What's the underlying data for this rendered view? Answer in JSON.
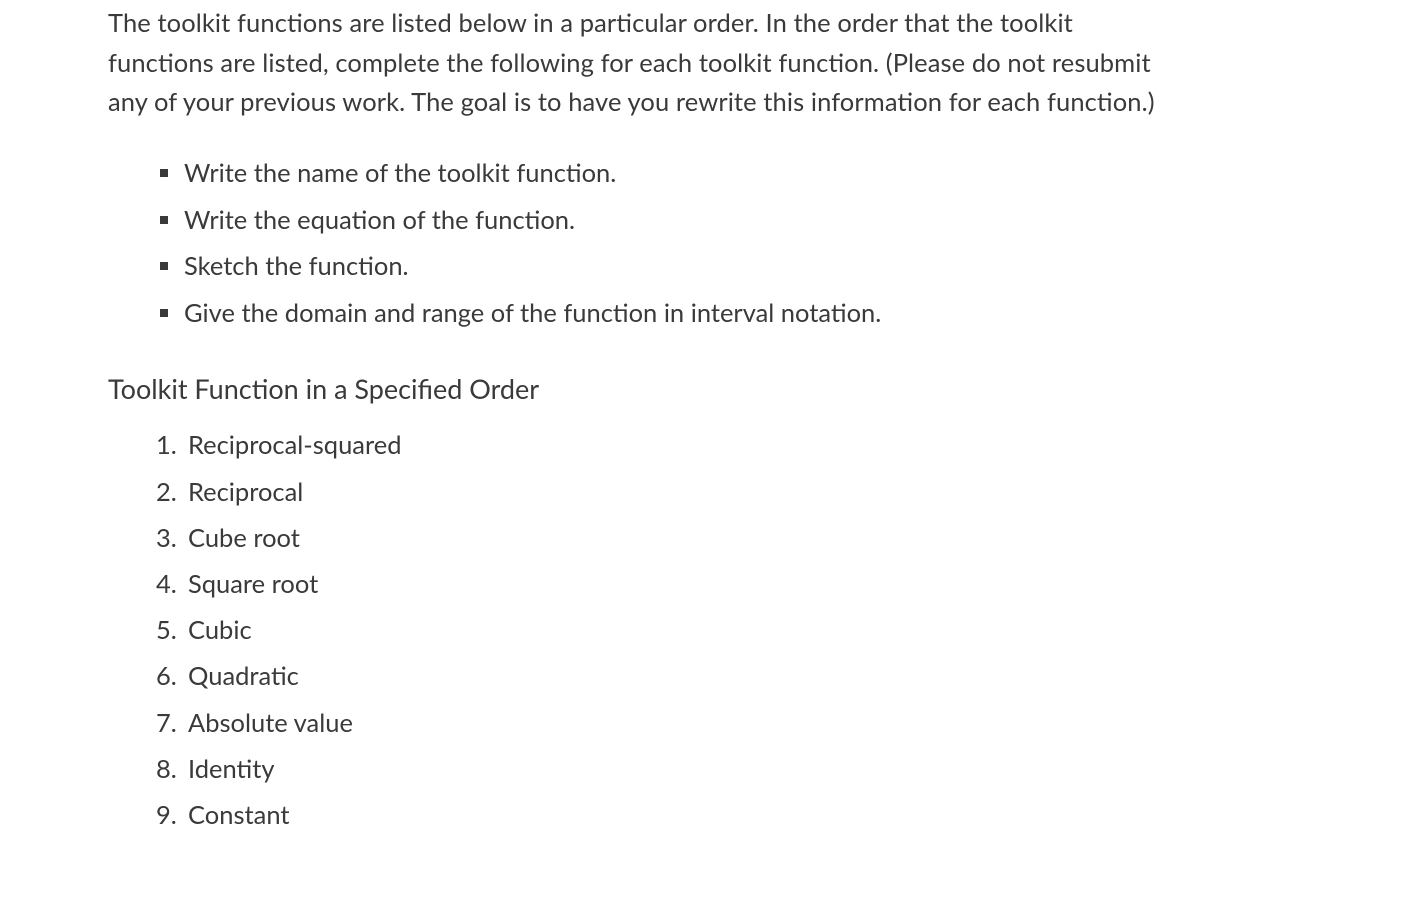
{
  "intro": "The toolkit functions are listed below in a particular order. In the order that the toolkit functions are listed, complete the following for each toolkit function. (Please do not resubmit any of your previous work. The goal is to have you rewrite this information for each function.)",
  "bullets": [
    "Write the name of the toolkit function.",
    "Write the equation of the function.",
    "Sketch the function.",
    "Give the domain and range of the function in interval notation."
  ],
  "subheading": "Toolkit Function in a Specified Order",
  "ordered": [
    "Reciprocal-squared",
    "Reciprocal",
    "Cube root",
    "Square root",
    "Cubic",
    "Quadratic",
    "Absolute value",
    "Identity",
    "Constant"
  ]
}
